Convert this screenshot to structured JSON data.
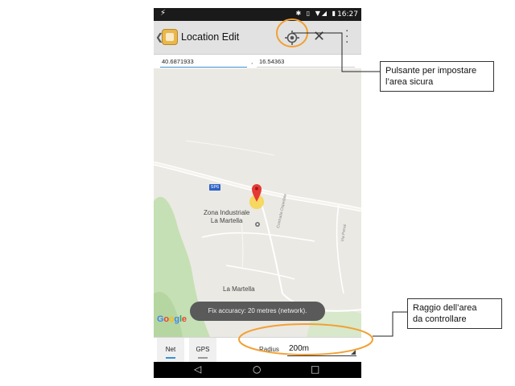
{
  "status_bar": {
    "time": "16:27",
    "left_icon": "bolt-icon",
    "right_icons": [
      "bluetooth-icon",
      "vibrate-icon",
      "wifi-icon",
      "signal-icon",
      "battery-icon"
    ]
  },
  "app_bar": {
    "title": "Location Edit",
    "actions": [
      "locate-icon",
      "close-icon",
      "more-vert-icon"
    ]
  },
  "coordinates": {
    "latitude": "40.6871933",
    "separator": ",",
    "longitude": "16.54363"
  },
  "map": {
    "road_badge": "SP6",
    "place_label_line1": "Zona Industriale",
    "place_label_line2": "La Martella",
    "locality_label": "La Martella",
    "road_label_1": "Contrada Ospedale",
    "road_label_2": "Via Petrai",
    "attribution_parts": [
      "G",
      "o",
      "o",
      "g",
      "l",
      "e"
    ],
    "attribution_colors": [
      "#4285F4",
      "#EA4335",
      "#FBBC05",
      "#4285F4",
      "#34A853",
      "#EA4335"
    ],
    "marker_color": "#e53935",
    "accuracy_circle_color": "#f7d34a",
    "toast": "Fix accuracy: 20 metres (network)."
  },
  "bottom_bar": {
    "tab_net": "Net",
    "tab_gps": "GPS",
    "radius_label": "Radius",
    "radius_value": "200m"
  },
  "nav_bar": {
    "back": "◁",
    "home": "○",
    "recents": "□"
  },
  "annotations": {
    "top_line1": "Pulsante per impostare",
    "top_line2": "l’area sicura",
    "bottom_line1": "Raggio dell’area",
    "bottom_line2": "da controllare",
    "highlight_color": "#f2a033"
  }
}
